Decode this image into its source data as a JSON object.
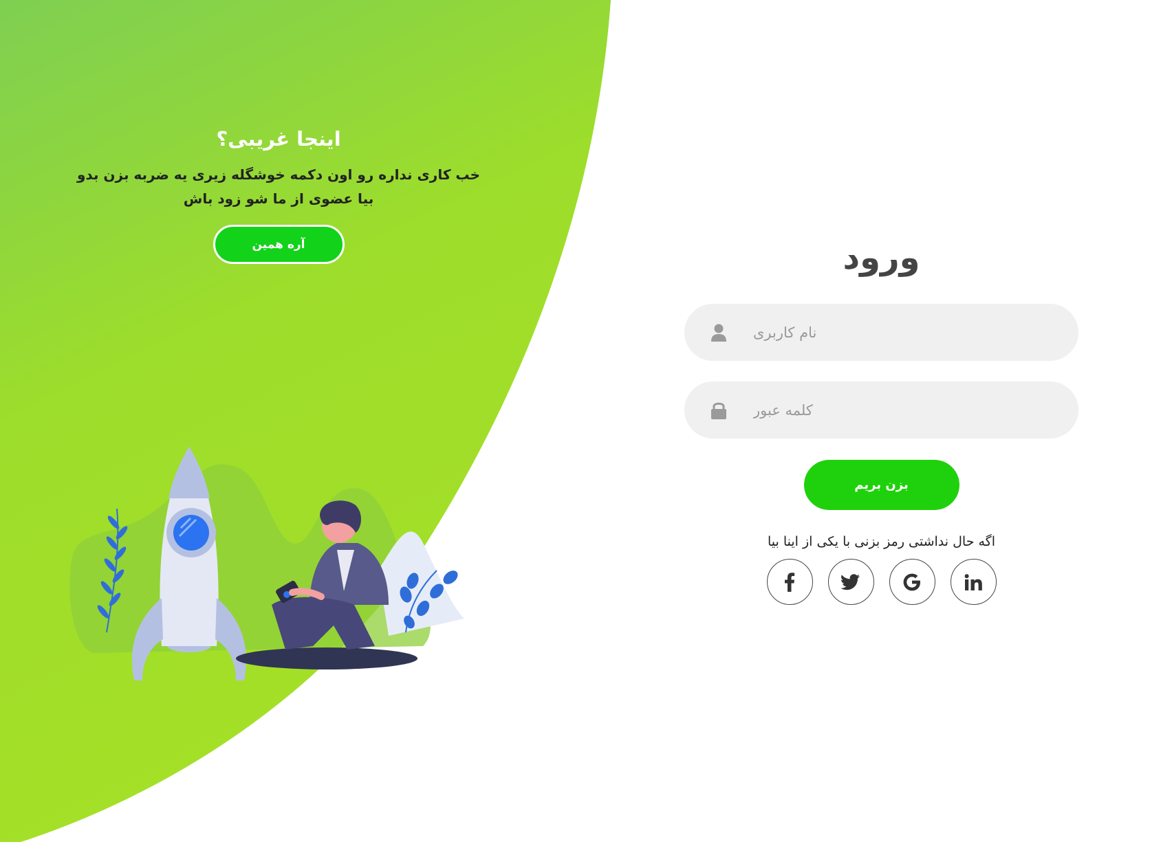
{
  "colors": {
    "accent": "#1fd10c",
    "gradient_top": "#7fd04f",
    "gradient_bottom": "#a4e02a",
    "field_bg": "#f0f0f0"
  },
  "left_panel": {
    "title": "اینجا غریبی؟",
    "description": "خب کاری نداره رو اون دکمه خوشگله زیری یه ضربه بزن بدو بیا عضوی از ما شو زود باش",
    "button_label": "آره همین"
  },
  "login_form": {
    "title": "ورود",
    "username": {
      "placeholder": "نام کاربری",
      "value": "",
      "icon": "user-icon"
    },
    "password": {
      "placeholder": "کلمه عبور",
      "value": "",
      "icon": "lock-icon"
    },
    "submit_label": "بزن بریم",
    "social_text": "اگه حال نداشتی رمز بزنی با یکی از اینا بیا",
    "socials": [
      {
        "name": "facebook",
        "icon": "facebook-icon"
      },
      {
        "name": "twitter",
        "icon": "twitter-icon"
      },
      {
        "name": "google",
        "icon": "google-icon"
      },
      {
        "name": "linkedin",
        "icon": "linkedin-icon"
      }
    ]
  }
}
